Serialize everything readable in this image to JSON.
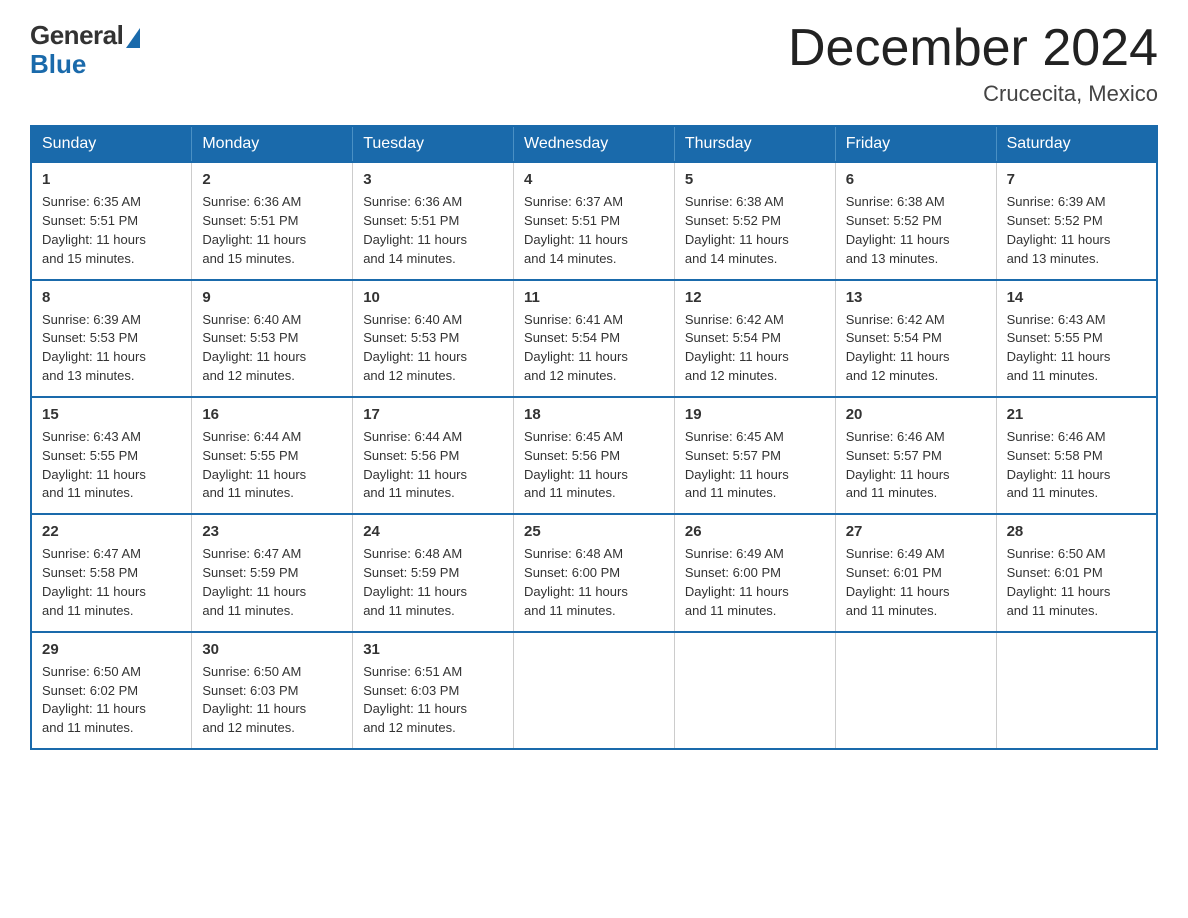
{
  "logo": {
    "general": "General",
    "blue": "Blue"
  },
  "header": {
    "month_year": "December 2024",
    "location": "Crucecita, Mexico"
  },
  "days_of_week": [
    "Sunday",
    "Monday",
    "Tuesday",
    "Wednesday",
    "Thursday",
    "Friday",
    "Saturday"
  ],
  "weeks": [
    [
      {
        "day": "1",
        "sunrise": "6:35 AM",
        "sunset": "5:51 PM",
        "daylight": "11 hours and 15 minutes."
      },
      {
        "day": "2",
        "sunrise": "6:36 AM",
        "sunset": "5:51 PM",
        "daylight": "11 hours and 15 minutes."
      },
      {
        "day": "3",
        "sunrise": "6:36 AM",
        "sunset": "5:51 PM",
        "daylight": "11 hours and 14 minutes."
      },
      {
        "day": "4",
        "sunrise": "6:37 AM",
        "sunset": "5:51 PM",
        "daylight": "11 hours and 14 minutes."
      },
      {
        "day": "5",
        "sunrise": "6:38 AM",
        "sunset": "5:52 PM",
        "daylight": "11 hours and 14 minutes."
      },
      {
        "day": "6",
        "sunrise": "6:38 AM",
        "sunset": "5:52 PM",
        "daylight": "11 hours and 13 minutes."
      },
      {
        "day": "7",
        "sunrise": "6:39 AM",
        "sunset": "5:52 PM",
        "daylight": "11 hours and 13 minutes."
      }
    ],
    [
      {
        "day": "8",
        "sunrise": "6:39 AM",
        "sunset": "5:53 PM",
        "daylight": "11 hours and 13 minutes."
      },
      {
        "day": "9",
        "sunrise": "6:40 AM",
        "sunset": "5:53 PM",
        "daylight": "11 hours and 12 minutes."
      },
      {
        "day": "10",
        "sunrise": "6:40 AM",
        "sunset": "5:53 PM",
        "daylight": "11 hours and 12 minutes."
      },
      {
        "day": "11",
        "sunrise": "6:41 AM",
        "sunset": "5:54 PM",
        "daylight": "11 hours and 12 minutes."
      },
      {
        "day": "12",
        "sunrise": "6:42 AM",
        "sunset": "5:54 PM",
        "daylight": "11 hours and 12 minutes."
      },
      {
        "day": "13",
        "sunrise": "6:42 AM",
        "sunset": "5:54 PM",
        "daylight": "11 hours and 12 minutes."
      },
      {
        "day": "14",
        "sunrise": "6:43 AM",
        "sunset": "5:55 PM",
        "daylight": "11 hours and 11 minutes."
      }
    ],
    [
      {
        "day": "15",
        "sunrise": "6:43 AM",
        "sunset": "5:55 PM",
        "daylight": "11 hours and 11 minutes."
      },
      {
        "day": "16",
        "sunrise": "6:44 AM",
        "sunset": "5:55 PM",
        "daylight": "11 hours and 11 minutes."
      },
      {
        "day": "17",
        "sunrise": "6:44 AM",
        "sunset": "5:56 PM",
        "daylight": "11 hours and 11 minutes."
      },
      {
        "day": "18",
        "sunrise": "6:45 AM",
        "sunset": "5:56 PM",
        "daylight": "11 hours and 11 minutes."
      },
      {
        "day": "19",
        "sunrise": "6:45 AM",
        "sunset": "5:57 PM",
        "daylight": "11 hours and 11 minutes."
      },
      {
        "day": "20",
        "sunrise": "6:46 AM",
        "sunset": "5:57 PM",
        "daylight": "11 hours and 11 minutes."
      },
      {
        "day": "21",
        "sunrise": "6:46 AM",
        "sunset": "5:58 PM",
        "daylight": "11 hours and 11 minutes."
      }
    ],
    [
      {
        "day": "22",
        "sunrise": "6:47 AM",
        "sunset": "5:58 PM",
        "daylight": "11 hours and 11 minutes."
      },
      {
        "day": "23",
        "sunrise": "6:47 AM",
        "sunset": "5:59 PM",
        "daylight": "11 hours and 11 minutes."
      },
      {
        "day": "24",
        "sunrise": "6:48 AM",
        "sunset": "5:59 PM",
        "daylight": "11 hours and 11 minutes."
      },
      {
        "day": "25",
        "sunrise": "6:48 AM",
        "sunset": "6:00 PM",
        "daylight": "11 hours and 11 minutes."
      },
      {
        "day": "26",
        "sunrise": "6:49 AM",
        "sunset": "6:00 PM",
        "daylight": "11 hours and 11 minutes."
      },
      {
        "day": "27",
        "sunrise": "6:49 AM",
        "sunset": "6:01 PM",
        "daylight": "11 hours and 11 minutes."
      },
      {
        "day": "28",
        "sunrise": "6:50 AM",
        "sunset": "6:01 PM",
        "daylight": "11 hours and 11 minutes."
      }
    ],
    [
      {
        "day": "29",
        "sunrise": "6:50 AM",
        "sunset": "6:02 PM",
        "daylight": "11 hours and 11 minutes."
      },
      {
        "day": "30",
        "sunrise": "6:50 AM",
        "sunset": "6:03 PM",
        "daylight": "11 hours and 12 minutes."
      },
      {
        "day": "31",
        "sunrise": "6:51 AM",
        "sunset": "6:03 PM",
        "daylight": "11 hours and 12 minutes."
      },
      null,
      null,
      null,
      null
    ]
  ],
  "labels": {
    "sunrise": "Sunrise:",
    "sunset": "Sunset:",
    "daylight": "Daylight:"
  }
}
